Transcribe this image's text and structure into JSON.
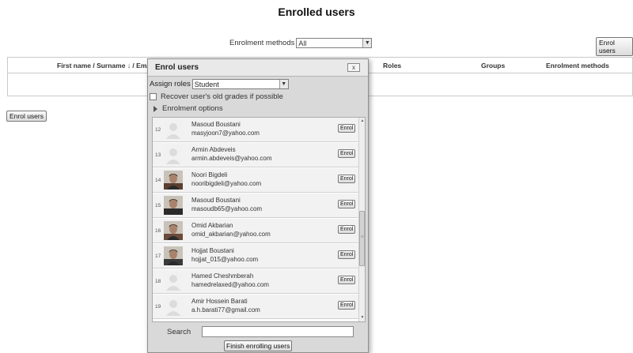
{
  "page": {
    "title": "Enrolled users"
  },
  "filter": {
    "label": "Enrolment methods",
    "selected": "All"
  },
  "buttons": {
    "enrol_users": "Enrol users"
  },
  "table": {
    "headers": [
      "First name / Surname ",
      "Roles",
      "Groups",
      "Enrolment methods"
    ],
    "sort_icon": "↓",
    "sort_suffix": " / Ema"
  },
  "dialog": {
    "title": "Enrol users",
    "close_icon": "x",
    "assign_roles_label": "Assign roles",
    "role_selected": "Student",
    "recover_label": "Recover user's old grades if possible",
    "options_label": "Enrolment options",
    "enrol_button": "Enrol",
    "search_label": "Search",
    "search_value": "",
    "finish_button": "Finish enrolling users",
    "users": [
      {
        "num": "12",
        "name": "Masoud Boustani",
        "email": "masyjoon7@yahoo.com",
        "photo": "default-avatar-icon"
      },
      {
        "num": "13",
        "name": "Armin Abdeveis",
        "email": "armin.abdeveis@yahoo.com",
        "photo": "default-avatar-icon"
      },
      {
        "num": "14",
        "name": "Noori Bigdeli",
        "email": "nooribigdeli@yahoo.com",
        "photo": "user-photo"
      },
      {
        "num": "15",
        "name": "Masoud Boustani",
        "email": "masoudb65@yahoo.com",
        "photo": "user-photo"
      },
      {
        "num": "16",
        "name": "Omid Akbarian",
        "email": "omid_akbarian@yahoo.com",
        "photo": "user-photo"
      },
      {
        "num": "17",
        "name": "Hojjat Boustani",
        "email": "hojjat_015@yahoo.com",
        "photo": "user-photo"
      },
      {
        "num": "18",
        "name": "Hamed Cheshmberah",
        "email": "hamedrelaxed@yahoo.com",
        "photo": "default-avatar-icon"
      },
      {
        "num": "19",
        "name": "Amir Hossein Barati",
        "email": "a.h.barati77@gmail.com",
        "photo": "default-avatar-icon"
      }
    ]
  }
}
